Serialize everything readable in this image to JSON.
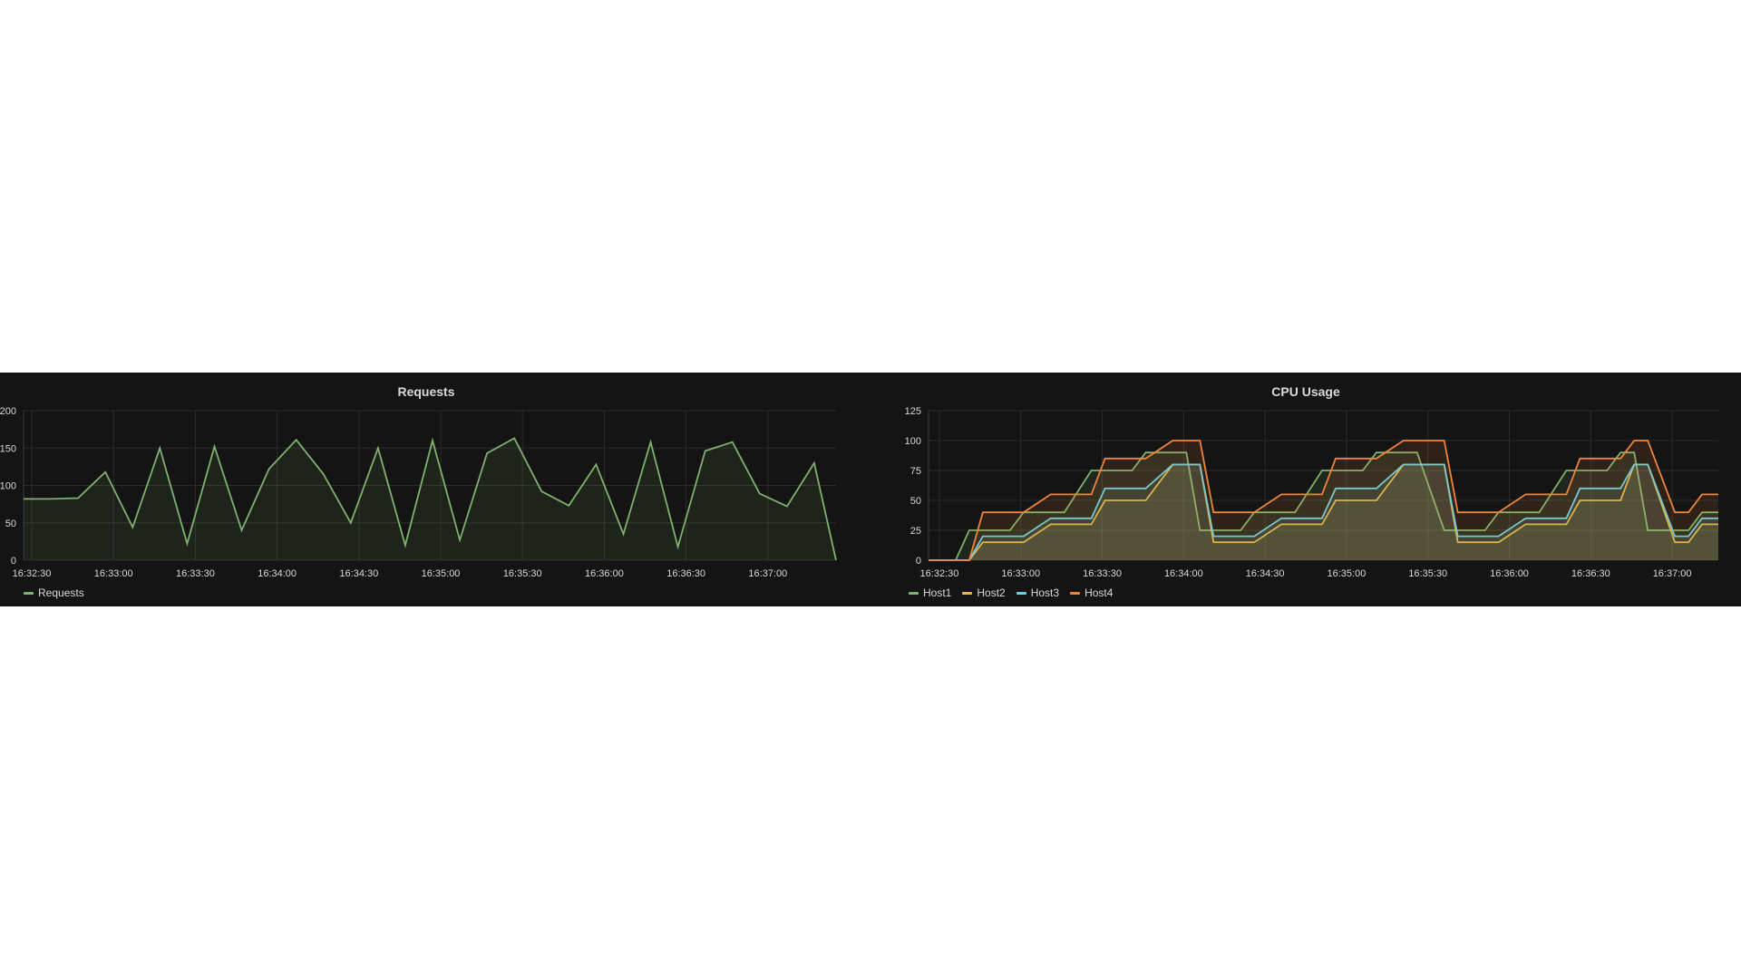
{
  "chart_data": [
    {
      "type": "area",
      "title": "Requests",
      "xlabel": "",
      "ylabel": "",
      "x_tick_labels": [
        "16:32:30",
        "16:33:00",
        "16:33:30",
        "16:34:00",
        "16:34:30",
        "16:35:00",
        "16:35:30",
        "16:36:00",
        "16:36:30",
        "16:37:00"
      ],
      "y_tick_labels": [
        "0",
        "50",
        "100",
        "150",
        "200"
      ],
      "ylim": [
        0,
        200
      ],
      "xlim": [
        "16:32:27",
        "16:37:25"
      ],
      "grid": true,
      "legend_position": "bottom-left",
      "x": [
        "16:32:27",
        "16:32:37",
        "16:32:47",
        "16:32:57",
        "16:33:07",
        "16:33:17",
        "16:33:27",
        "16:33:37",
        "16:33:47",
        "16:33:57",
        "16:34:07",
        "16:34:17",
        "16:34:27",
        "16:34:37",
        "16:34:47",
        "16:34:57",
        "16:35:07",
        "16:35:17",
        "16:35:27",
        "16:35:37",
        "16:35:47",
        "16:35:57",
        "16:36:07",
        "16:36:17",
        "16:36:27",
        "16:36:37",
        "16:36:47",
        "16:36:57",
        "16:37:07",
        "16:37:17",
        "16:37:25"
      ],
      "series": [
        {
          "name": "Requests",
          "color": "#7eb26d",
          "values": [
            82,
            82,
            83,
            118,
            44,
            150,
            22,
            152,
            40,
            122,
            161,
            115,
            50,
            150,
            20,
            160,
            27,
            143,
            163,
            92,
            73,
            128,
            35,
            158,
            18,
            146,
            158,
            89,
            72,
            130,
            0
          ]
        }
      ]
    },
    {
      "type": "area",
      "title": "CPU Usage",
      "xlabel": "",
      "ylabel": "",
      "x_tick_labels": [
        "16:32:30",
        "16:33:00",
        "16:33:30",
        "16:34:00",
        "16:34:30",
        "16:35:00",
        "16:35:30",
        "16:36:00",
        "16:36:30",
        "16:37:00"
      ],
      "y_tick_labels": [
        "0",
        "25",
        "50",
        "75",
        "100",
        "125"
      ],
      "ylim": [
        0,
        125
      ],
      "xlim": [
        "16:32:26",
        "16:37:17"
      ],
      "grid": true,
      "legend_position": "bottom-left",
      "x": [
        "16:32:26",
        "16:32:31",
        "16:32:36",
        "16:32:41",
        "16:32:46",
        "16:32:56",
        "16:33:01",
        "16:33:11",
        "16:33:16",
        "16:33:26",
        "16:33:31",
        "16:33:41",
        "16:33:46",
        "16:33:56",
        "16:34:01",
        "16:34:06",
        "16:34:11",
        "16:34:21",
        "16:34:26",
        "16:34:36",
        "16:34:41",
        "16:34:51",
        "16:34:56",
        "16:35:06",
        "16:35:11",
        "16:35:21",
        "16:35:26",
        "16:35:36",
        "16:35:41",
        "16:35:51",
        "16:35:56",
        "16:36:06",
        "16:36:11",
        "16:36:21",
        "16:36:26",
        "16:36:36",
        "16:36:41",
        "16:36:46",
        "16:36:51",
        "16:37:01",
        "16:37:06",
        "16:37:11",
        "16:37:17"
      ],
      "series": [
        {
          "name": "Host1",
          "color": "#7eb26d",
          "values": [
            0,
            0,
            0,
            25,
            25,
            25,
            40,
            40,
            40,
            75,
            75,
            75,
            90,
            90,
            90,
            25,
            25,
            25,
            40,
            40,
            40,
            75,
            75,
            75,
            90,
            90,
            90,
            25,
            25,
            25,
            40,
            40,
            40,
            75,
            75,
            75,
            90,
            90,
            25,
            25,
            25,
            40,
            40
          ]
        },
        {
          "name": "Host2",
          "color": "#eab839",
          "values": [
            0,
            0,
            0,
            0,
            15,
            15,
            15,
            30,
            30,
            30,
            50,
            50,
            50,
            80,
            80,
            80,
            15,
            15,
            15,
            30,
            30,
            30,
            50,
            50,
            50,
            80,
            80,
            80,
            15,
            15,
            15,
            30,
            30,
            30,
            50,
            50,
            50,
            80,
            80,
            15,
            15,
            30,
            30
          ]
        },
        {
          "name": "Host3",
          "color": "#6ed0e0",
          "values": [
            0,
            0,
            0,
            0,
            20,
            20,
            20,
            35,
            35,
            35,
            60,
            60,
            60,
            80,
            80,
            80,
            20,
            20,
            20,
            35,
            35,
            35,
            60,
            60,
            60,
            80,
            80,
            80,
            20,
            20,
            20,
            35,
            35,
            35,
            60,
            60,
            60,
            80,
            80,
            20,
            20,
            35,
            35
          ]
        },
        {
          "name": "Host4",
          "color": "#ef843c",
          "values": [
            0,
            0,
            0,
            0,
            40,
            40,
            40,
            55,
            55,
            55,
            85,
            85,
            85,
            100,
            100,
            100,
            40,
            40,
            40,
            55,
            55,
            55,
            85,
            85,
            85,
            100,
            100,
            100,
            40,
            40,
            40,
            55,
            55,
            55,
            85,
            85,
            85,
            100,
            100,
            40,
            40,
            55,
            55
          ]
        }
      ]
    }
  ]
}
